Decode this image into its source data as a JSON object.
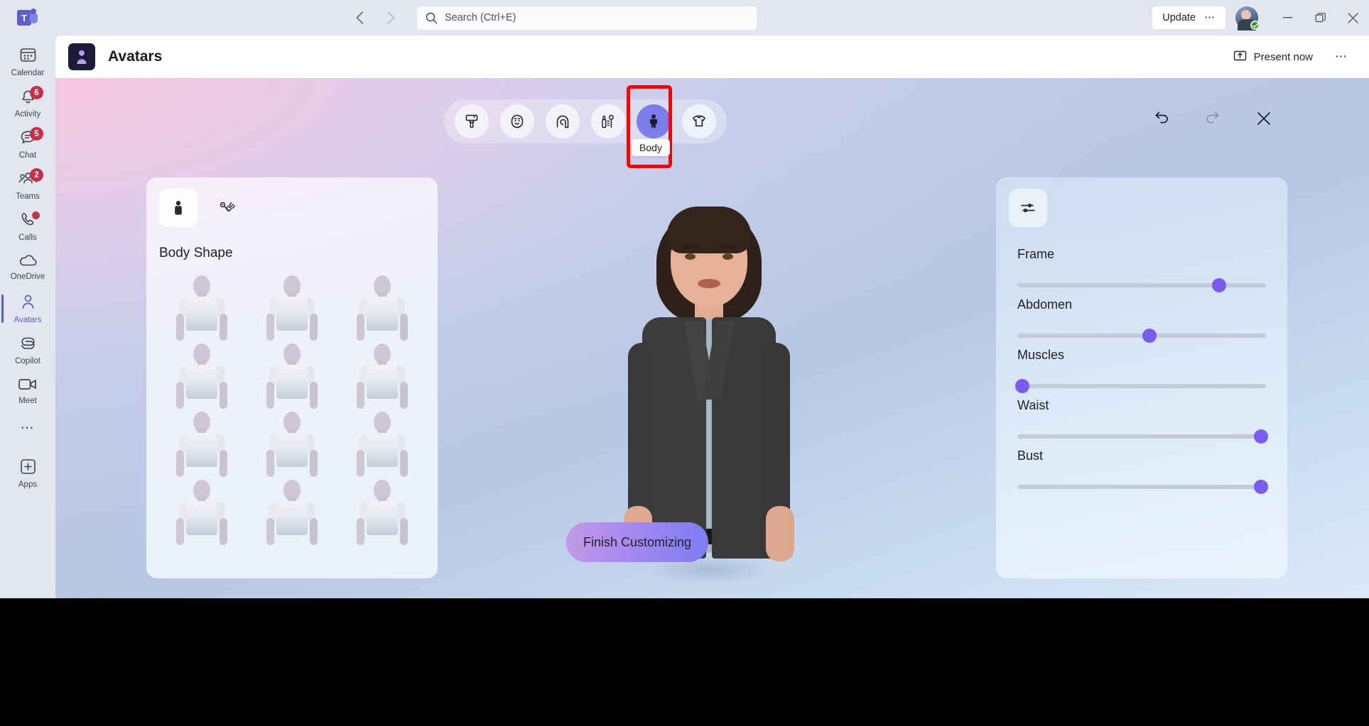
{
  "titlebar": {
    "logo_icon": "teams-logo-icon",
    "logo_letter": "T",
    "back_icon": "chevron-left-icon",
    "forward_icon": "chevron-right-icon",
    "search": {
      "icon": "search-icon",
      "placeholder": "Search (Ctrl+E)",
      "value": ""
    },
    "update_label": "Update",
    "update_more_icon": "ellipsis-icon",
    "avatar_icon": "user-avatar",
    "presence_icon": "available-check-icon",
    "minimize_icon": "minimize-icon",
    "maximize_icon": "maximize-icon",
    "close_icon": "close-icon"
  },
  "apphead": {
    "app_icon": "avatars-app-icon",
    "title": "Avatars",
    "present_icon": "share-screen-icon",
    "present_label": "Present now",
    "more_icon": "ellipsis-icon"
  },
  "rail": {
    "items": [
      {
        "label": "Calendar",
        "icon": "calendar-icon",
        "badge": "",
        "active": false
      },
      {
        "label": "Activity",
        "icon": "bell-icon",
        "badge": "6",
        "active": false
      },
      {
        "label": "Chat",
        "icon": "chat-bubble-icon",
        "badge": "5",
        "active": false
      },
      {
        "label": "Teams",
        "icon": "people-icon",
        "badge": "2",
        "active": false
      },
      {
        "label": "Calls",
        "icon": "phone-icon",
        "badge": "dot",
        "active": false
      },
      {
        "label": "OneDrive",
        "icon": "cloud-icon",
        "badge": "",
        "active": false
      },
      {
        "label": "Avatars",
        "icon": "person-outline-icon",
        "badge": "",
        "active": true
      },
      {
        "label": "Copilot",
        "icon": "copilot-icon",
        "badge": "",
        "active": false
      },
      {
        "label": "Meet",
        "icon": "video-camera-icon",
        "badge": "",
        "active": false
      }
    ],
    "more_icon": "ellipsis-icon",
    "apps": {
      "label": "Apps",
      "icon": "apps-plus-icon"
    }
  },
  "toolbar": {
    "tabs": [
      {
        "name": "paintbrush",
        "icon": "paintbrush-icon",
        "selected": false
      },
      {
        "name": "face",
        "icon": "face-smile-icon",
        "selected": false
      },
      {
        "name": "hair",
        "icon": "hair-icon",
        "selected": false
      },
      {
        "name": "makeup",
        "icon": "makeup-icon",
        "selected": false
      },
      {
        "name": "body",
        "icon": "body-person-icon",
        "selected": true
      },
      {
        "name": "clothing",
        "icon": "tshirt-icon",
        "selected": false
      }
    ],
    "selected_tooltip": "Body",
    "highlight_color": "#ff0000",
    "undo_icon": "undo-icon",
    "redo_icon": "redo-icon",
    "close_icon": "close-icon"
  },
  "left_panel": {
    "tabs": [
      {
        "name": "body-shape",
        "icon": "person-filled-icon",
        "selected": true
      },
      {
        "name": "prosthetics",
        "icon": "prosthetic-arm-icon",
        "selected": false
      }
    ],
    "section_title": "Body Shape",
    "options": [
      "body-shape-1",
      "body-shape-2",
      "body-shape-3",
      "body-shape-4",
      "body-shape-5",
      "body-shape-6",
      "body-shape-7",
      "body-shape-8",
      "body-shape-9",
      "body-shape-10",
      "body-shape-11",
      "body-shape-12"
    ]
  },
  "right_panel": {
    "tabs": [
      {
        "name": "sliders",
        "icon": "sliders-icon",
        "selected": true
      }
    ],
    "sliders": [
      {
        "label": "Frame",
        "value": 81
      },
      {
        "label": "Abdomen",
        "value": 53
      },
      {
        "label": "Muscles",
        "value": 2
      },
      {
        "label": "Waist",
        "value": 98
      },
      {
        "label": "Bust",
        "value": 98
      }
    ],
    "accent_color": "#7b5cf0",
    "track_color": "#c3cbd6"
  },
  "stage": {
    "finish_label": "Finish Customizing",
    "avatar_preview_name": "avatar-3d-preview"
  }
}
